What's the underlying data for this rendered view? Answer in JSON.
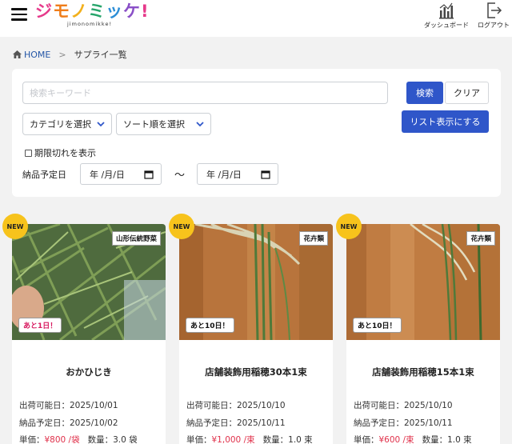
{
  "header": {
    "logo_text": "ジモノミッケ!",
    "logo_sub": "jimonomikke!",
    "dashboard_label": "ダッシュボード",
    "logout_label": "ログアウト"
  },
  "breadcrumb": {
    "home": "HOME",
    "separator": ">",
    "current": "サプライ一覧"
  },
  "search": {
    "keyword_placeholder": "検索キーワード",
    "keyword_value": "",
    "search_label": "検索",
    "clear_label": "クリア",
    "category_select": "カテゴリを選択",
    "sort_select": "ソート順を選択",
    "list_view_label": "リスト表示にする",
    "expired_label": "期限切れを表示",
    "delivery_date_label": "納品予定日",
    "date_from": "年 /月/日",
    "date_to": "年 /月/日",
    "range_separator": "〜"
  },
  "colors": {
    "primary": "#2f56c9",
    "price": "#e0314b",
    "new_badge": "#f7c31c",
    "urgent": "#d81b60"
  },
  "cards": [
    {
      "badge": "NEW",
      "category": "山形伝統野菜",
      "days_left": "あと1日！",
      "urgent": true,
      "title": "おかひじき",
      "ship_date": "出荷可能日：2025/10/01",
      "delivery_date": "納品予定日：2025/10/02",
      "unit_price_label": "単価：",
      "unit_price": "¥800 /袋",
      "quantity": "数量：3.0 袋"
    },
    {
      "badge": "NEW",
      "category": "花卉類",
      "days_left": "あと10日！",
      "urgent": false,
      "title": "店舗装飾用稲穂30本1束",
      "ship_date": "出荷可能日：2025/10/10",
      "delivery_date": "納品予定日：2025/10/11",
      "unit_price_label": "単価：",
      "unit_price": "¥1,000 /束",
      "quantity": "数量：1.0 束"
    },
    {
      "badge": "NEW",
      "category": "花卉類",
      "days_left": "あと10日！",
      "urgent": false,
      "title": "店舗装飾用稲穂15本1束",
      "ship_date": "出荷可能日：2025/10/10",
      "delivery_date": "納品予定日：2025/10/11",
      "unit_price_label": "単価：",
      "unit_price": "¥600 /束",
      "quantity": "数量：1.0 束"
    }
  ]
}
